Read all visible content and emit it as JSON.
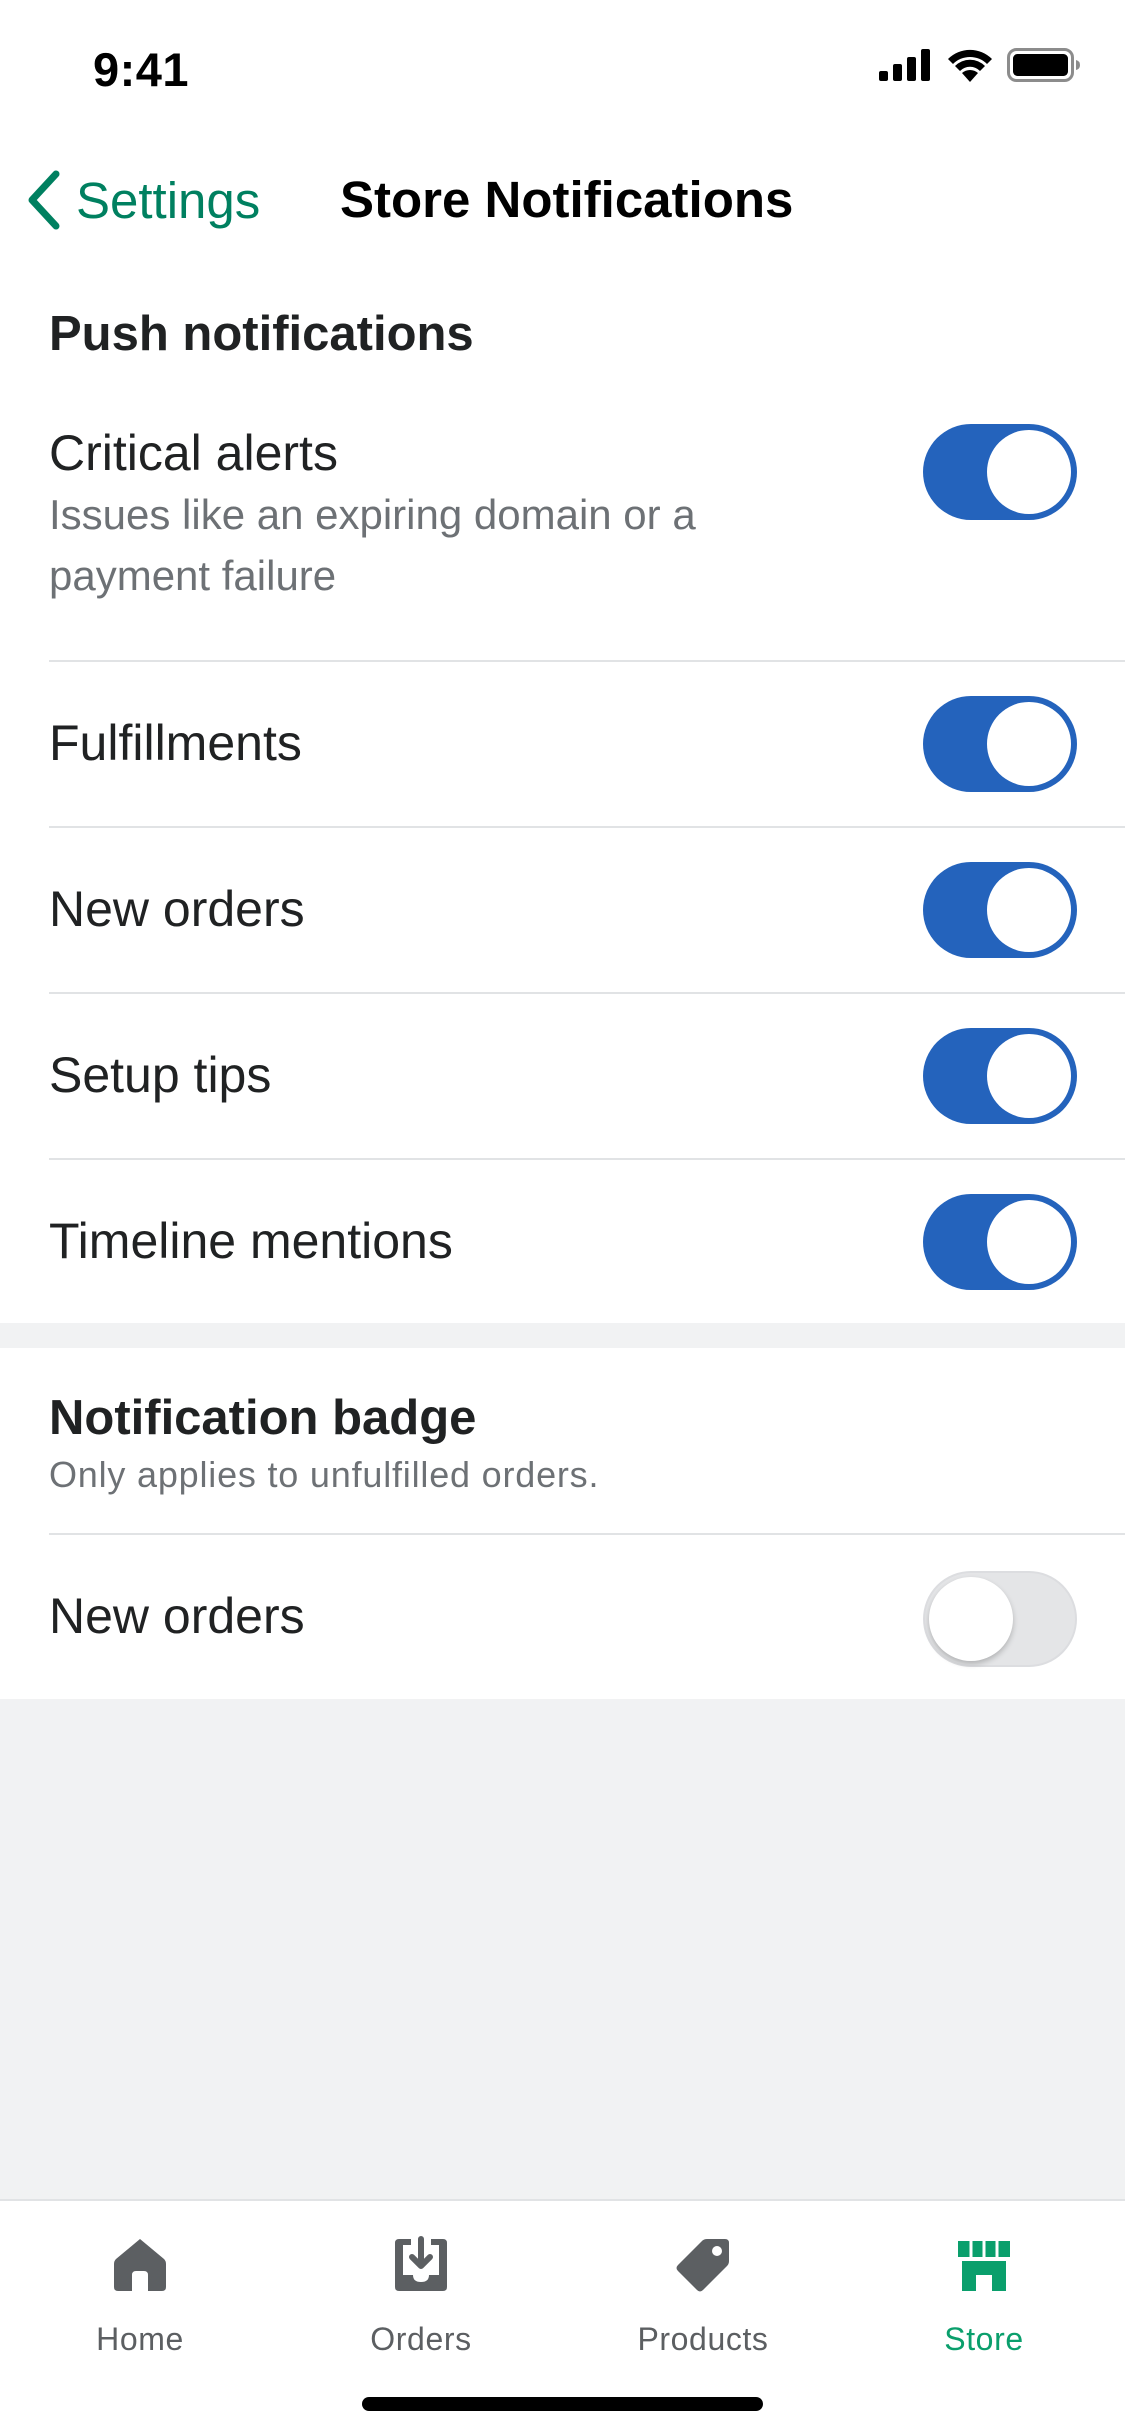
{
  "status_bar": {
    "time": "9:41"
  },
  "nav": {
    "back_label": "Settings",
    "title": "Store Notifications"
  },
  "push_section": {
    "heading": "Push notifications",
    "rows": [
      {
        "label": "Critical alerts",
        "description": "Issues like an expiring domain or a payment failure",
        "enabled": true
      },
      {
        "label": "Fulfillments",
        "enabled": true
      },
      {
        "label": "New orders",
        "enabled": true
      },
      {
        "label": "Setup tips",
        "enabled": true
      },
      {
        "label": "Timeline mentions",
        "enabled": true
      }
    ]
  },
  "badge_section": {
    "heading": "Notification badge",
    "subtitle": "Only applies to unfulfilled orders.",
    "rows": [
      {
        "label": "New orders",
        "enabled": false
      }
    ]
  },
  "tab_bar": {
    "tabs": [
      {
        "label": "Home",
        "icon": "home-icon",
        "active": false
      },
      {
        "label": "Orders",
        "icon": "orders-icon",
        "active": false
      },
      {
        "label": "Products",
        "icon": "tag-icon",
        "active": false
      },
      {
        "label": "Store",
        "icon": "store-icon",
        "active": true
      }
    ]
  },
  "colors": {
    "accent": "#008060",
    "toggle_on": "#2463bc",
    "tab_active": "#0a9f6c",
    "background": "#f1f2f3"
  }
}
